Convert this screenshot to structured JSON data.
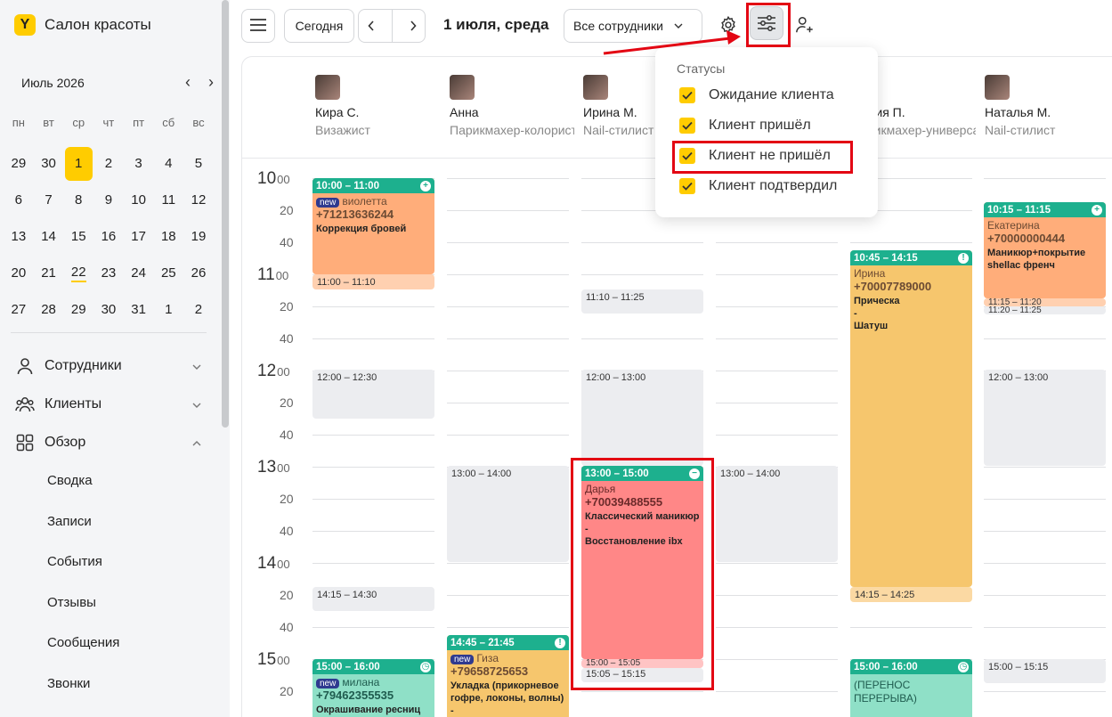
{
  "app": {
    "logo_letter": "Y",
    "title": "Салон красоты"
  },
  "mini_calendar": {
    "month": "Июль 2026",
    "weekdays": [
      "пн",
      "вт",
      "ср",
      "чт",
      "пт",
      "сб",
      "вс"
    ],
    "days": [
      "29",
      "30",
      "1",
      "2",
      "3",
      "4",
      "5",
      "6",
      "7",
      "8",
      "9",
      "10",
      "11",
      "12",
      "13",
      "14",
      "15",
      "16",
      "17",
      "18",
      "19",
      "20",
      "21",
      "22",
      "23",
      "24",
      "25",
      "26",
      "27",
      "28",
      "29",
      "30",
      "31",
      "1",
      "2"
    ],
    "selected_index": 2,
    "today_index": 23
  },
  "nav": {
    "employees": "Сотрудники",
    "clients": "Клиенты",
    "overview": "Обзор",
    "sub": [
      "Сводка",
      "Записи",
      "События",
      "Отзывы",
      "Сообщения",
      "Звонки"
    ]
  },
  "toolbar": {
    "today_label": "Сегодня",
    "date_title": "1 июля, среда",
    "staff_filter": "Все сотрудники"
  },
  "staff": [
    {
      "name": "Кира С.",
      "role": "Визажист"
    },
    {
      "name": "Анна",
      "role": "Парикмахер-колорист"
    },
    {
      "name": "Ирина М.",
      "role": "Nail-стилист"
    },
    {
      "name": "",
      "role": ""
    },
    {
      "name": "Мария П.",
      "role": "Парикмахер-универсал"
    },
    {
      "name": "Наталья М.",
      "role": "Nail-стилист"
    }
  ],
  "time_axis": {
    "hours": [
      "10",
      "11",
      "12",
      "13",
      "14",
      "15"
    ],
    "minute_suffix": "00",
    "minutes": [
      "20",
      "40"
    ]
  },
  "blocks": {
    "c1_1": "11:00 – 11:10",
    "c1_2": "12:00 – 12:30",
    "c1_3": "14:15 – 14:30",
    "c2_1": "13:00 – 14:00",
    "c3_1": "11:10 – 11:25",
    "c3_2": "12:00 – 13:00",
    "c3_3": "15:00 – 15:05",
    "c3_4": "15:05 – 15:15",
    "c4_1": "13:00 – 14:00",
    "c5_1": "14:15 – 14:25",
    "c6_1": "11:15 – 11:20",
    "c6_2": "11:20 – 11:25",
    "c6_3": "12:00 – 13:00",
    "c6_4": "15:00 – 15:15"
  },
  "appointments": {
    "a1": {
      "time": "10:00 – 11:00",
      "badge": "new",
      "name": "виолетта",
      "phone": "+71213636244",
      "service": "Коррекция бровей"
    },
    "a2": {
      "time": "15:00 – 16:00",
      "badge": "new",
      "name": "милана",
      "phone": "+79462355535",
      "service": "Окрашивание ресниц"
    },
    "a3": {
      "time": "14:45 – 21:45",
      "badge": "new",
      "name": "Гиза",
      "phone": "+79658725653",
      "service": "Укладка (прикорневое гофре, локоны, волны)",
      "extra": "-"
    },
    "a4": {
      "time": "13:00 – 15:00",
      "name": "Дарья",
      "phone": "+70039488555",
      "service": "Классический маникюр",
      "dash": "-",
      "service2": "Восстановление ibx"
    },
    "a5": {
      "time": "10:45 – 14:15",
      "name": "Ирина",
      "phone": "+70007789000",
      "service": "Прическа",
      "dash": "-",
      "service2": "Шатуш"
    },
    "a6": {
      "time": "15:00 – 16:00",
      "note": "(ПЕРЕНОС ПЕРЕРЫВА)"
    },
    "a7": {
      "time": "10:15 – 11:15",
      "name": "Екатерина",
      "phone": "+70000000444",
      "service": "Маникюр+покрытие shellac френч"
    }
  },
  "status_menu": {
    "title": "Статусы",
    "items": [
      "Ожидание клиента",
      "Клиент пришёл",
      "Клиент не пришёл",
      "Клиент подтвердил"
    ]
  }
}
